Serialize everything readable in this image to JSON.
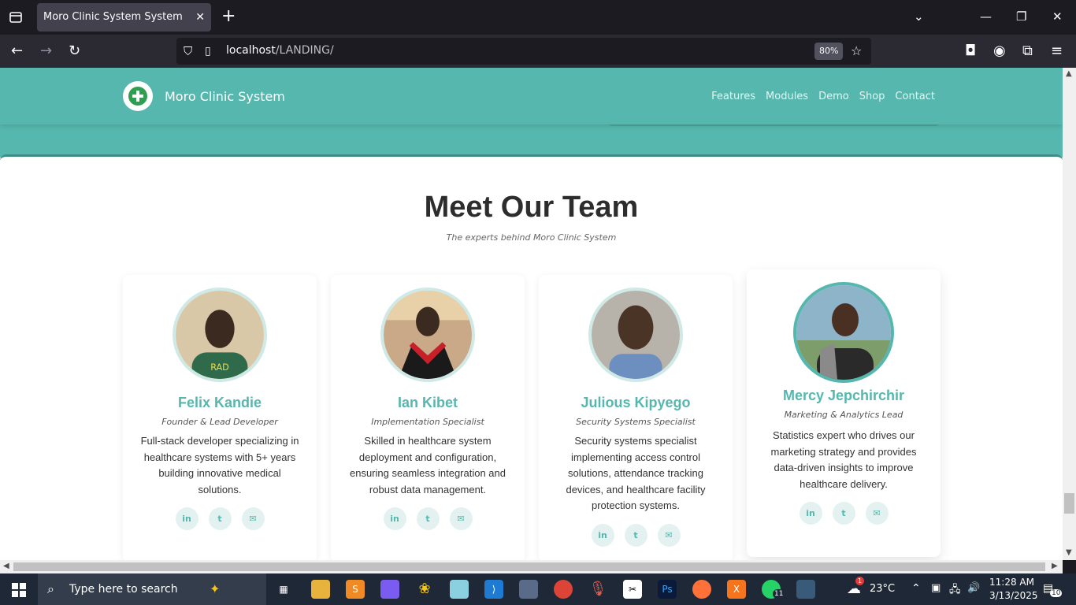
{
  "browser": {
    "tab_title": "Moro Clinic System System",
    "url_host": "localhost",
    "url_path": "/LANDING/",
    "zoom": "80%"
  },
  "site": {
    "brand": "Moro Clinic System",
    "nav": [
      "Features",
      "Modules",
      "Demo",
      "Shop",
      "Contact"
    ]
  },
  "team": {
    "title": "Meet Our Team",
    "subtitle": "The experts behind Moro Clinic System",
    "members": [
      {
        "name": "Felix Kandie",
        "role": "Founder & Lead Developer",
        "bio": "Full-stack developer specializing in healthcare systems with 5+ years building innovative medical solutions."
      },
      {
        "name": "Ian Kibet",
        "role": "Implementation Specialist",
        "bio": "Skilled in healthcare system deployment and configuration, ensuring seamless integration and robust data management."
      },
      {
        "name": "Julious Kipyego",
        "role": "Security Systems Specialist",
        "bio": "Security systems specialist implementing access control solutions, attendance tracking devices, and healthcare facility protection systems."
      },
      {
        "name": "Mercy Jepchirchir",
        "role": "Marketing & Analytics Lead",
        "bio": "Statistics expert who drives our marketing strategy and provides data-driven insights to improve healthcare delivery."
      }
    ],
    "social_icons": [
      "linkedin-icon",
      "twitter-icon",
      "email-icon"
    ]
  },
  "taskbar": {
    "search_placeholder": "Type here to search",
    "weather": "23°C",
    "time": "11:28 AM",
    "date": "3/13/2025",
    "whatsapp_badge": "11",
    "notifications": "10",
    "weather_badge": "1"
  },
  "colors": {
    "accent": "#55b7ad",
    "avatar_ring": "#cfe9e6"
  }
}
